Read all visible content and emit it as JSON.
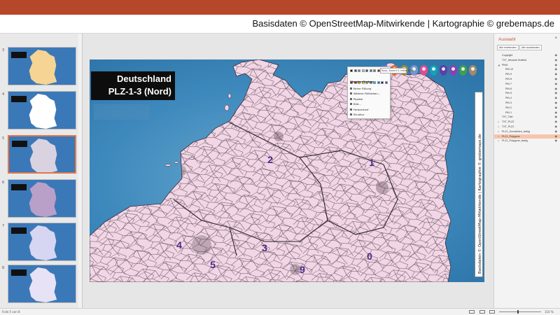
{
  "credit": {
    "text": "Basisdaten ©  OpenStreetMap-Mitwirkende | Kartographie © grebemaps.de"
  },
  "thumbnails": {
    "numbers": [
      "3",
      "4",
      "5",
      "6",
      "7",
      "8"
    ],
    "selected_index": 2,
    "map_colors": [
      "#f6d493",
      "#ffffff",
      "#d9d2e0",
      "#b9a0c9",
      "#d6d6f3",
      "#e8e2f6"
    ]
  },
  "slide": {
    "title_line1": "Deutschland",
    "title_line2": "PLZ-1-3 (Nord)",
    "region_labels": [
      {
        "id": "region-label-1",
        "text": "1"
      },
      {
        "id": "region-label-2",
        "text": "2"
      },
      {
        "id": "region-label-3",
        "text": "3"
      },
      {
        "id": "region-label-4",
        "text": "4"
      },
      {
        "id": "region-label-5",
        "text": "5"
      },
      {
        "id": "region-label-9",
        "text": "9"
      },
      {
        "id": "region-label-0",
        "text": "0"
      }
    ],
    "vertical_credit": "Basisdaten © OpenStreetMap-Mitwirkende | Kartographie © grebemaps.de",
    "pin_colors": [
      "#7c6bd6",
      "#e36a2e",
      "#9b8a3a",
      "#7a94c6",
      "#e04d8f",
      "#11a3b5",
      "#5b3fa6",
      "#8d3fb1",
      "#40a04a",
      "#a08a6a"
    ]
  },
  "colors": {
    "accent": "#b7472a",
    "map_fill": "#f2d6e6",
    "map_border": "#4d3b47",
    "label_color": "#4a2a86",
    "selection": "#f7c6ad"
  },
  "context_menu": {
    "swatch_colors": [
      "#000000",
      "#404040",
      "#7f7f7f",
      "#bfbfbf",
      "#1f4e79",
      "#2e75b6",
      "#548235",
      "#c00000",
      "#7030a0",
      "#ffffff",
      "#c00000",
      "#ff0000",
      "#ffc000",
      "#ffff00",
      "#92d050",
      "#00b050",
      "#00b0f0",
      "#0070c0",
      "#002060",
      "#7030a0"
    ],
    "standard_heading": "Standardfarben",
    "items": [
      "Keine Füllung",
      "Weitere Füllfarben...",
      "Pipette",
      "Bild...",
      "Farbverlauf",
      "Struktur"
    ],
    "tooltip": "Rosa, Akzent 5, heller 80%"
  },
  "pane": {
    "title": "Auswahl",
    "close": "×",
    "show_all": "Alle einblenden",
    "hide_all": "Alle ausblenden",
    "eye_icon": "eye-icon",
    "layers": [
      {
        "name": "Copyright",
        "level": 0,
        "expand": ""
      },
      {
        "name": "TXT_Hinweis-Textfeld",
        "level": 0,
        "expand": ""
      },
      {
        "name": "PINS",
        "level": 0,
        "expand": "◢"
      },
      {
        "name": "PIN 10",
        "level": 1,
        "expand": ""
      },
      {
        "name": "PIN 9",
        "level": 1,
        "expand": ""
      },
      {
        "name": "PIN 8",
        "level": 1,
        "expand": ""
      },
      {
        "name": "PIN 7",
        "level": 1,
        "expand": ""
      },
      {
        "name": "PIN 6",
        "level": 1,
        "expand": ""
      },
      {
        "name": "PIN 5",
        "level": 1,
        "expand": ""
      },
      {
        "name": "PIN 4",
        "level": 1,
        "expand": ""
      },
      {
        "name": "PIN 3",
        "level": 1,
        "expand": ""
      },
      {
        "name": "PIN 2",
        "level": 1,
        "expand": ""
      },
      {
        "name": "PIN 1",
        "level": 1,
        "expand": ""
      },
      {
        "name": "TXT_Titel",
        "level": 0,
        "expand": ""
      },
      {
        "name": "TXT_PLZ2",
        "level": 0,
        "expand": "▷"
      },
      {
        "name": "TXT_PLZ1",
        "level": 0,
        "expand": "▷"
      },
      {
        "name": "PLZ1_Grenzlinien_farbig",
        "level": 0,
        "expand": "▷"
      },
      {
        "name": "PLZ1_Polygone",
        "level": 0,
        "expand": "▷",
        "selected": true
      },
      {
        "name": "PLZ1_Polygone_farbig",
        "level": 0,
        "expand": "▷"
      }
    ]
  },
  "status": {
    "slide_info": "Folie 5 von 8",
    "zoom": "116 %"
  }
}
